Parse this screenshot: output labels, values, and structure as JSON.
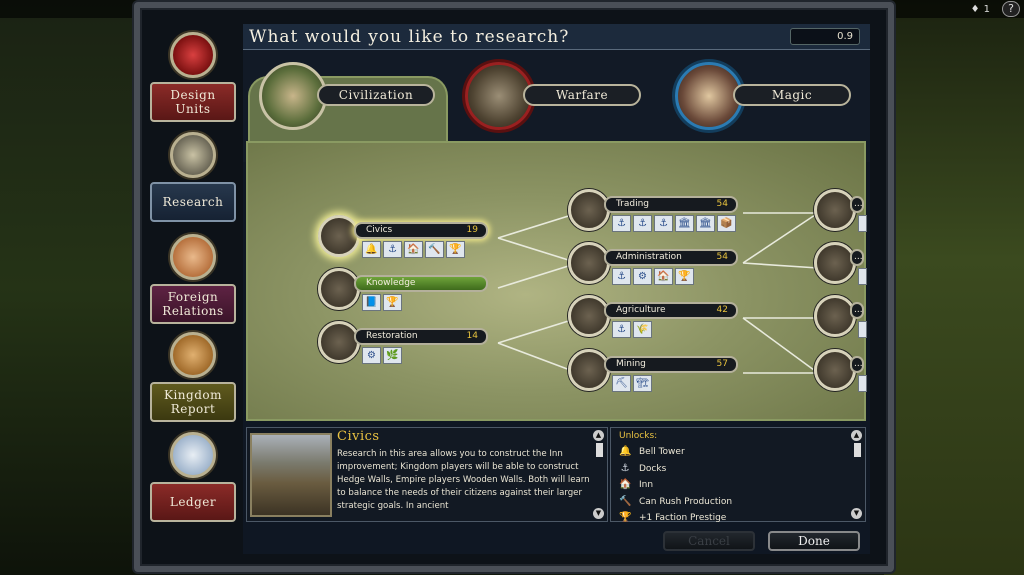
{
  "topbar": {
    "resource_count": "1",
    "help_label": "?"
  },
  "window": {
    "title": "What would you like to research?",
    "version": "0.9"
  },
  "sidebar": {
    "items": [
      {
        "label": "Design Units",
        "icon": "fist-icon",
        "style": "red"
      },
      {
        "label": "Research",
        "icon": "compass-icon",
        "style": "blue",
        "active": true
      },
      {
        "label": "Foreign Relations",
        "icon": "handshake-icon",
        "style": "purple"
      },
      {
        "label": "Kingdom Report",
        "icon": "castle-icon",
        "style": "olive"
      },
      {
        "label": "Ledger",
        "icon": "scroll-icon",
        "style": "red"
      }
    ]
  },
  "tabs": [
    {
      "label": "Civilization",
      "active": true,
      "ring_color": "#6f8a3c"
    },
    {
      "label": "Warfare",
      "active": false,
      "ring_color": "#9a2020"
    },
    {
      "label": "Magic",
      "active": false,
      "ring_color": "#2b7bb3"
    }
  ],
  "tree": {
    "nodes": [
      {
        "id": "civics",
        "label": "Civics",
        "count": "19",
        "selected": true,
        "icons": [
          "🔔",
          "⚓",
          "🏠",
          "🔨",
          "🏆"
        ]
      },
      {
        "id": "knowledge",
        "label": "Knowledge",
        "count": "",
        "completed": true,
        "icons": [
          "📘",
          "🏆"
        ]
      },
      {
        "id": "restoration",
        "label": "Restoration",
        "count": "14",
        "icons": [
          "⚙",
          "🌿"
        ]
      },
      {
        "id": "trading",
        "label": "Trading",
        "count": "54",
        "icons": [
          "⚓",
          "⚓",
          "⚓",
          "🏛",
          "🏛",
          "📦"
        ]
      },
      {
        "id": "administration",
        "label": "Administration",
        "count": "54",
        "icons": [
          "⚓",
          "⚙",
          "🏠",
          "🏆"
        ]
      },
      {
        "id": "agriculture",
        "label": "Agriculture",
        "count": "42",
        "icons": [
          "⚓",
          "🌾"
        ]
      },
      {
        "id": "mining",
        "label": "Mining",
        "count": "57",
        "icons": [
          "⛏",
          "🏗"
        ]
      },
      {
        "id": "r1",
        "label": "...",
        "count": "",
        "icons": [
          ""
        ]
      },
      {
        "id": "r2",
        "label": "...",
        "count": "",
        "icons": [
          ""
        ]
      },
      {
        "id": "r3",
        "label": "...",
        "count": "",
        "icons": [
          ""
        ]
      },
      {
        "id": "r4",
        "label": "...",
        "count": "",
        "icons": [
          ""
        ]
      }
    ]
  },
  "info": {
    "title": "Civics",
    "text": "Research in this area allows you to construct the Inn improvement; Kingdom players will be able to construct Hedge Walls, Empire players Wooden Walls. Both will learn to balance the needs of their citizens against their larger strategic goals.  In ancient"
  },
  "unlocks": {
    "title": "Unlocks:",
    "items": [
      {
        "icon": "bell-icon",
        "glyph": "🔔",
        "label": "Bell Tower"
      },
      {
        "icon": "docks-icon",
        "glyph": "⚓",
        "label": "Docks"
      },
      {
        "icon": "inn-icon",
        "glyph": "🏠",
        "label": "Inn"
      },
      {
        "icon": "hammer-icon",
        "glyph": "🔨",
        "label": "Can Rush Production"
      },
      {
        "icon": "trophy-icon",
        "glyph": "🏆",
        "label": "+1 Faction Prestige"
      }
    ]
  },
  "buttons": {
    "cancel": "Cancel",
    "done": "Done"
  }
}
